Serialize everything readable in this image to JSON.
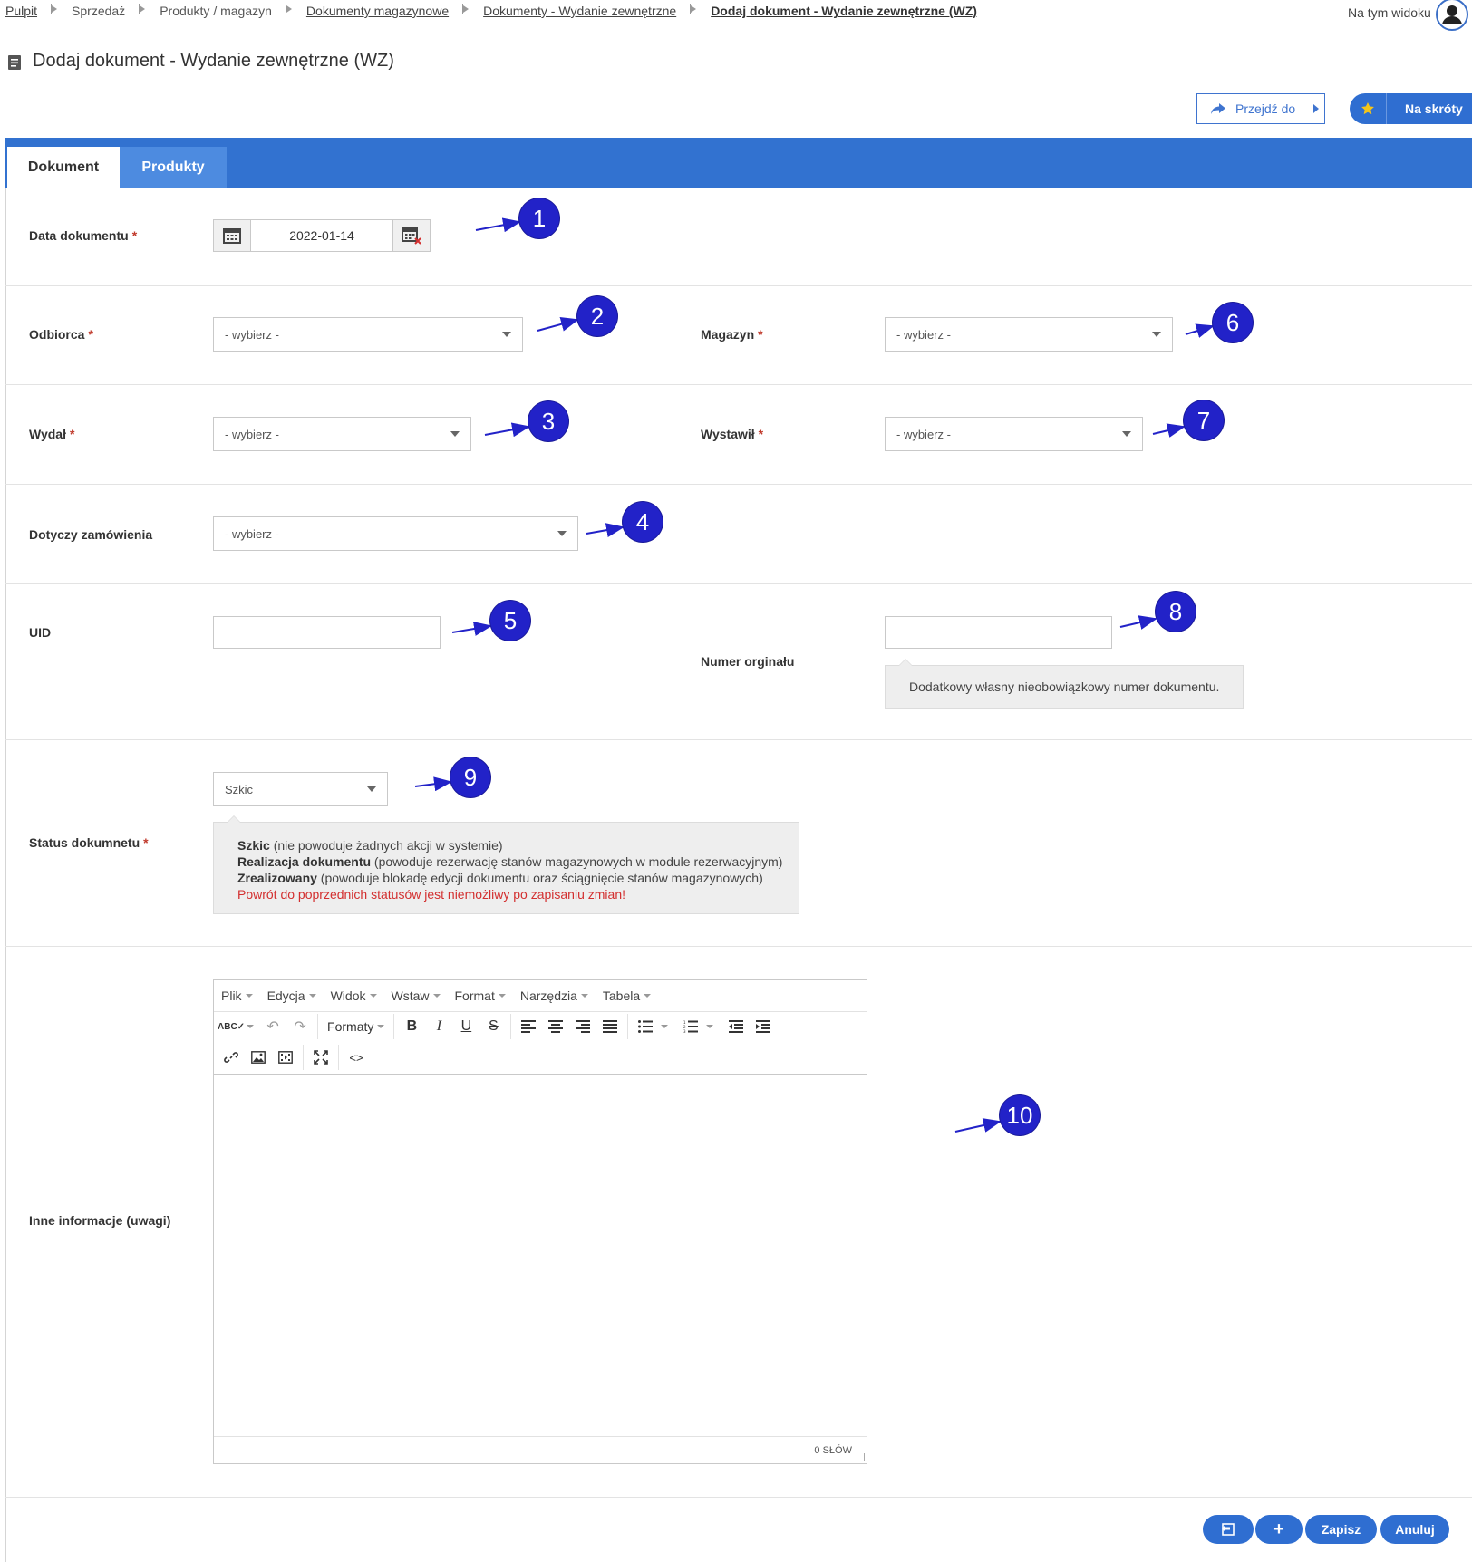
{
  "breadcrumb": {
    "items": [
      {
        "label": "Pulpit",
        "style": "link"
      },
      {
        "label": "Sprzedaż",
        "style": "plain"
      },
      {
        "label": "Produkty / magazyn",
        "style": "plain"
      },
      {
        "label": "Dokumenty magazynowe",
        "style": "link"
      },
      {
        "label": "Dokumenty - Wydanie zewnętrzne",
        "style": "link"
      },
      {
        "label": "Dodaj dokument - Wydanie zewnętrzne (WZ)",
        "style": "current"
      }
    ]
  },
  "header": {
    "view_label": "Na tym widoku",
    "page_title": "Dodaj dokument - Wydanie zewnętrzne (WZ)",
    "goto_label": "Przejdź do",
    "shortcuts_label": "Na skróty"
  },
  "tabs": [
    {
      "label": "Dokument",
      "active": true
    },
    {
      "label": "Produkty",
      "active": false
    }
  ],
  "form": {
    "required_mark": "*",
    "date": {
      "label": "Data dokumentu",
      "value": "2022-01-14"
    },
    "recipient": {
      "label": "Odbiorca",
      "value": "- wybierz -"
    },
    "warehouse": {
      "label": "Magazyn",
      "value": "- wybierz -"
    },
    "issued_by": {
      "label": "Wydał",
      "value": "- wybierz -"
    },
    "issuer": {
      "label": "Wystawił",
      "value": "- wybierz -"
    },
    "order": {
      "label": "Dotyczy zamówienia",
      "value": "- wybierz -"
    },
    "uid": {
      "label": "UID",
      "value": ""
    },
    "original_number": {
      "label": "Numer orginału",
      "value": "",
      "hint": "Dodatkowy własny nieobowiązkowy numer dokumentu."
    },
    "status": {
      "label": "Status dokumnetu",
      "value": "Szkic",
      "hint": [
        {
          "bold": "Szkic",
          "text": " (nie powoduje żadnych akcji w systemie)"
        },
        {
          "bold": "Realizacja dokumentu",
          "text": " (powoduje rezerwację stanów magazynowych w module rezerwacyjnym)"
        },
        {
          "bold": "Zrealizowany",
          "text": " (powoduje blokadę edycji dokumentu oraz ściągnięcie stanów magazynowych)"
        }
      ],
      "warning": "Powrót do poprzednich statusów jest niemożliwy po zapisaniu zmian!"
    },
    "notes": {
      "label": "Inne informacje (uwagi)"
    }
  },
  "editor": {
    "menu": [
      "Plik",
      "Edycja",
      "Widok",
      "Wstaw",
      "Format",
      "Narzędzia",
      "Tabela"
    ],
    "formats_label": "Formaty",
    "word_count": "0 SŁÓW"
  },
  "markers": [
    "1",
    "2",
    "3",
    "4",
    "5",
    "6",
    "7",
    "8",
    "9",
    "10"
  ],
  "footer": {
    "save_label": "Zapisz",
    "cancel_label": "Anuluj"
  },
  "colors": {
    "accent": "#3272d0",
    "marker": "#2222c8",
    "required": "#c0392b",
    "warning": "#d32f2f"
  }
}
